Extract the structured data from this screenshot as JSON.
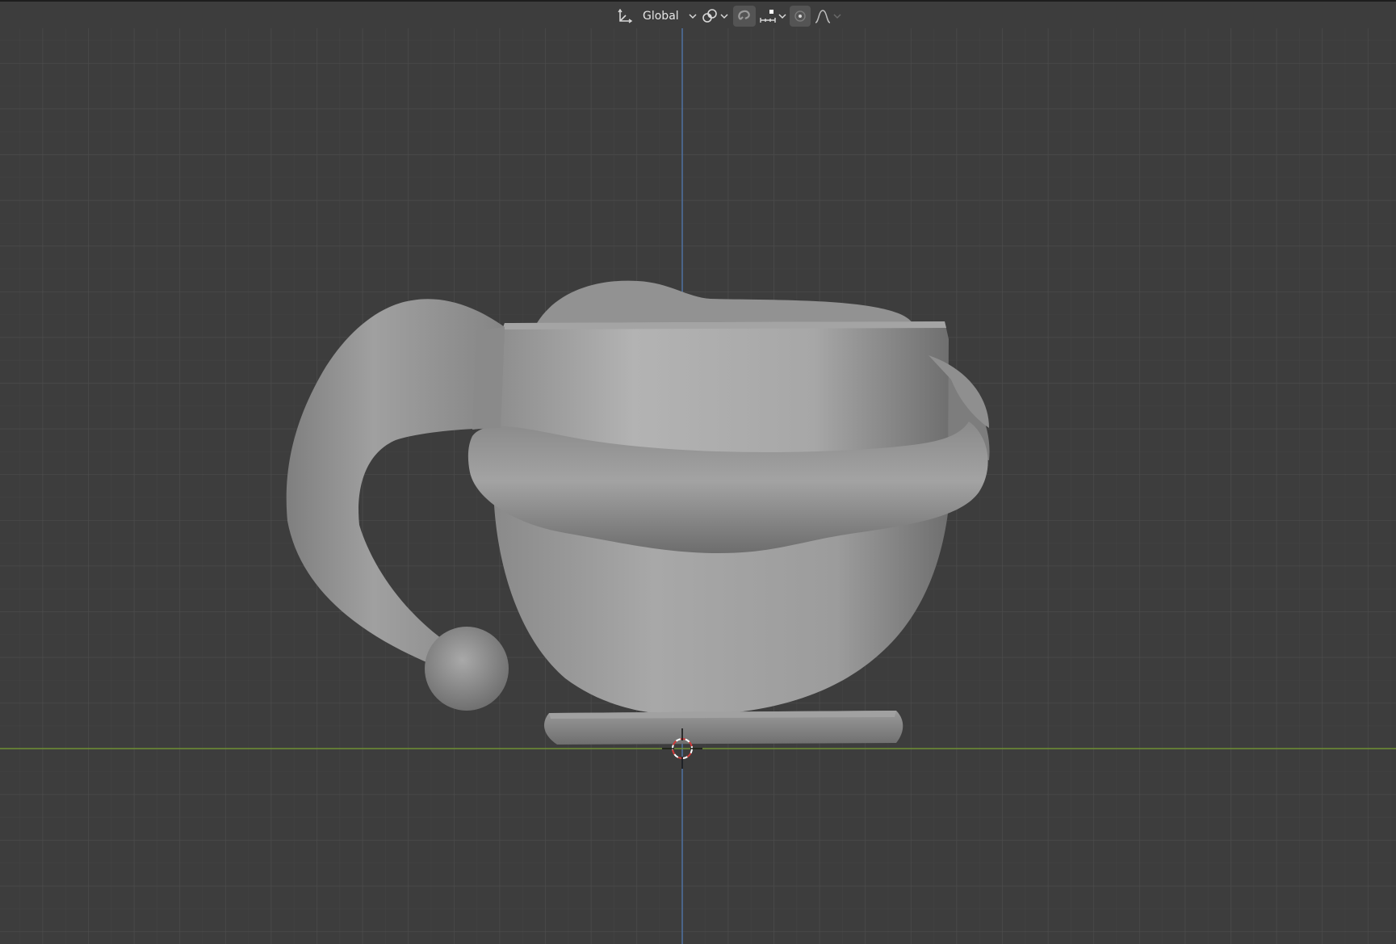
{
  "header": {
    "transform_orientation": {
      "label": "Global",
      "icon": "transform-orientation-icon"
    },
    "pivot_point": {
      "icon": "pivot-point-icon"
    },
    "snapping": {
      "icon": "magnet-icon",
      "target_icon": "snap-increment-icon"
    },
    "proportional_editing": {
      "icon": "proportional-editing-icon",
      "falloff_icon": "falloff-curve-icon"
    }
  },
  "viewport": {
    "background": "#3d3d3d",
    "grid_color": "#4a4a4a",
    "x_axis_color": "#7a9a3a",
    "z_axis_color": "#4f74a8",
    "object": "mug-model",
    "cursor": "3d-cursor"
  }
}
